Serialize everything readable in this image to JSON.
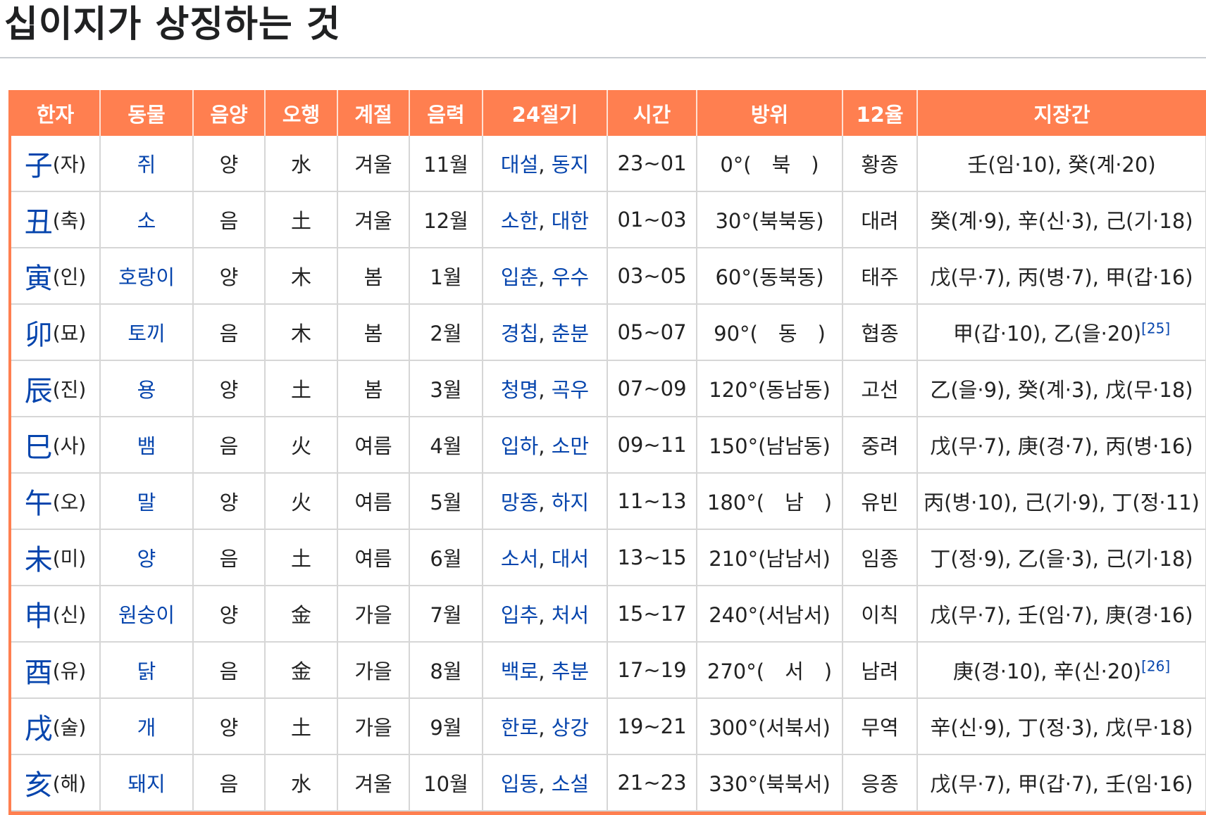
{
  "page": {
    "title": "십이지가 상징하는 것"
  },
  "colors": {
    "header_bg": "#ff7f50",
    "header_text": "#ffffff",
    "link": "#0645ad",
    "grid": "#d6d6d6"
  },
  "table": {
    "headers": [
      "한자",
      "동물",
      "음양",
      "오행",
      "계절",
      "음력",
      "24절기",
      "시간",
      "방위",
      "12율",
      "지장간"
    ],
    "rows": [
      {
        "hanja": "子",
        "reading": "(자)",
        "animal": "쥐",
        "yinyang": "양",
        "element": "水",
        "season": "겨울",
        "month": "11월",
        "term1": "대설",
        "term2": "동지",
        "time": "23~01",
        "direction": "0°(　북　)",
        "yul": "황종",
        "jijanggan": "壬(임·10), 癸(계·20)",
        "ref": ""
      },
      {
        "hanja": "丑",
        "reading": "(축)",
        "animal": "소",
        "yinyang": "음",
        "element": "土",
        "season": "겨울",
        "month": "12월",
        "term1": "소한",
        "term2": "대한",
        "time": "01~03",
        "direction": "30°(북북동)",
        "yul": "대려",
        "jijanggan": "癸(계·9), 辛(신·3), 己(기·18)",
        "ref": ""
      },
      {
        "hanja": "寅",
        "reading": "(인)",
        "animal": "호랑이",
        "yinyang": "양",
        "element": "木",
        "season": "봄",
        "month": "1월",
        "term1": "입춘",
        "term2": "우수",
        "time": "03~05",
        "direction": "60°(동북동)",
        "yul": "태주",
        "jijanggan": "戊(무·7), 丙(병·7), 甲(갑·16)",
        "ref": ""
      },
      {
        "hanja": "卯",
        "reading": "(묘)",
        "animal": "토끼",
        "yinyang": "음",
        "element": "木",
        "season": "봄",
        "month": "2월",
        "term1": "경칩",
        "term2": "춘분",
        "time": "05~07",
        "direction": "90°(　동　)",
        "yul": "협종",
        "jijanggan": "甲(갑·10), 乙(을·20)",
        "ref": "[25]"
      },
      {
        "hanja": "辰",
        "reading": "(진)",
        "animal": "용",
        "yinyang": "양",
        "element": "土",
        "season": "봄",
        "month": "3월",
        "term1": "청명",
        "term2": "곡우",
        "time": "07~09",
        "direction": "120°(동남동)",
        "yul": "고선",
        "jijanggan": "乙(을·9), 癸(계·3), 戊(무·18)",
        "ref": ""
      },
      {
        "hanja": "巳",
        "reading": "(사)",
        "animal": "뱀",
        "yinyang": "음",
        "element": "火",
        "season": "여름",
        "month": "4월",
        "term1": "입하",
        "term2": "소만",
        "time": "09~11",
        "direction": "150°(남남동)",
        "yul": "중려",
        "jijanggan": "戊(무·7), 庚(경·7), 丙(병·16)",
        "ref": ""
      },
      {
        "hanja": "午",
        "reading": "(오)",
        "animal": "말",
        "yinyang": "양",
        "element": "火",
        "season": "여름",
        "month": "5월",
        "term1": "망종",
        "term2": "하지",
        "time": "11~13",
        "direction": "180°(　남　)",
        "yul": "유빈",
        "jijanggan": "丙(병·10), 己(기·9), 丁(정·11)",
        "ref": ""
      },
      {
        "hanja": "未",
        "reading": "(미)",
        "animal": "양",
        "yinyang": "음",
        "element": "土",
        "season": "여름",
        "month": "6월",
        "term1": "소서",
        "term2": "대서",
        "time": "13~15",
        "direction": "210°(남남서)",
        "yul": "임종",
        "jijanggan": "丁(정·9), 乙(을·3), 己(기·18)",
        "ref": ""
      },
      {
        "hanja": "申",
        "reading": "(신)",
        "animal": "원숭이",
        "yinyang": "양",
        "element": "金",
        "season": "가을",
        "month": "7월",
        "term1": "입추",
        "term2": "처서",
        "time": "15~17",
        "direction": "240°(서남서)",
        "yul": "이칙",
        "jijanggan": "戊(무·7), 壬(임·7), 庚(경·16)",
        "ref": ""
      },
      {
        "hanja": "酉",
        "reading": "(유)",
        "animal": "닭",
        "yinyang": "음",
        "element": "金",
        "season": "가을",
        "month": "8월",
        "term1": "백로",
        "term2": "추분",
        "time": "17~19",
        "direction": "270°(　서　)",
        "yul": "남려",
        "jijanggan": "庚(경·10), 辛(신·20)",
        "ref": "[26]"
      },
      {
        "hanja": "戌",
        "reading": "(술)",
        "animal": "개",
        "yinyang": "양",
        "element": "土",
        "season": "가을",
        "month": "9월",
        "term1": "한로",
        "term2": "상강",
        "time": "19~21",
        "direction": "300°(서북서)",
        "yul": "무역",
        "jijanggan": "辛(신·9), 丁(정·3), 戊(무·18)",
        "ref": ""
      },
      {
        "hanja": "亥",
        "reading": "(해)",
        "animal": "돼지",
        "yinyang": "음",
        "element": "水",
        "season": "겨울",
        "month": "10월",
        "term1": "입동",
        "term2": "소설",
        "time": "21~23",
        "direction": "330°(북북서)",
        "yul": "응종",
        "jijanggan": "戊(무·7), 甲(갑·7), 壬(임·16)",
        "ref": ""
      }
    ]
  }
}
